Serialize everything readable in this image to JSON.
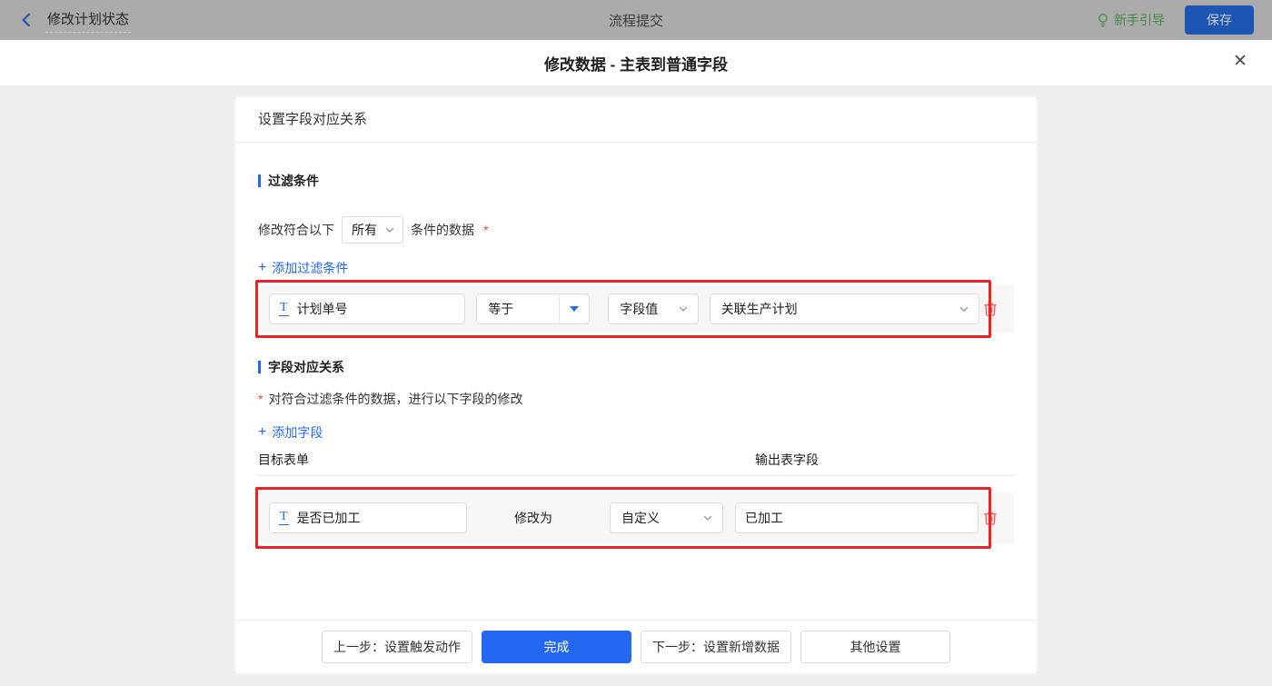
{
  "top_bar": {
    "back_title": "修改计划状态",
    "center_title": "流程提交",
    "guide_label": "新手引导",
    "save_label": "保存"
  },
  "modal": {
    "title": "修改数据 - 主表到普通字段",
    "close_icon": "✕"
  },
  "panel": {
    "header": "设置字段对应关系"
  },
  "filter_section": {
    "title": "过滤条件",
    "match_prefix": "修改符合以下",
    "match_value": "所有",
    "match_suffix": "条件的数据",
    "required_mark": "*",
    "add_label": "添加过滤条件",
    "row": {
      "field": "计划单号",
      "operator": "等于",
      "value_type": "字段值",
      "value_field": "关联生产计划"
    }
  },
  "mapping_section": {
    "title": "字段对应关系",
    "required_mark": "*",
    "description": "对符合过滤条件的数据，进行以下字段的修改",
    "add_label": "添加字段",
    "columns": {
      "target": "目标表单",
      "output": "输出表字段"
    },
    "row": {
      "target_field": "是否已加工",
      "modify_label": "修改为",
      "mode": "自定义",
      "value": "已加工"
    }
  },
  "footer": {
    "prev": "上一步：设置触发动作",
    "done": "完成",
    "next": "下一步：设置新增数据",
    "other": "其他设置"
  },
  "icons": {
    "plus": "+",
    "text_field": "T"
  },
  "colors": {
    "accent": "#2468f2",
    "danger": "#f25e5e",
    "highlight_red": "#ee2222",
    "guide_green": "#57b657"
  }
}
